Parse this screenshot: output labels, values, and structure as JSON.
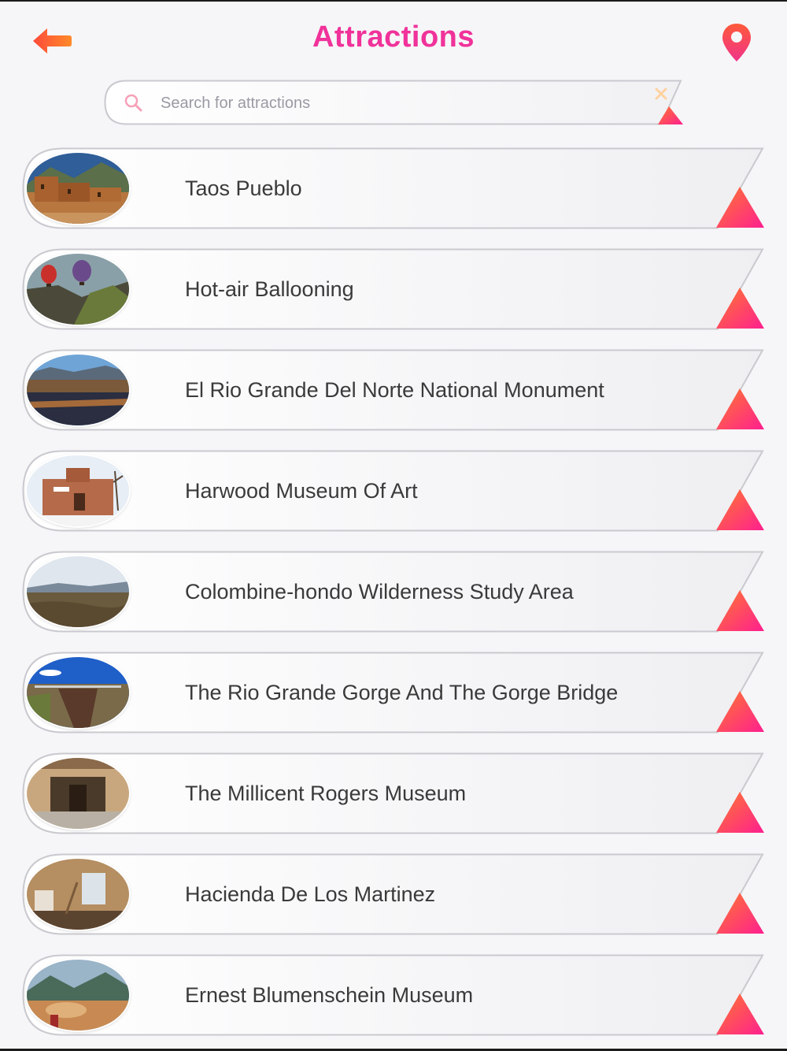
{
  "header": {
    "title": "Attractions",
    "back_icon": "back-arrow-icon",
    "map_icon": "map-pin-icon"
  },
  "search": {
    "placeholder": "Search for attractions",
    "value": "",
    "icon": "search-icon",
    "clear_icon": "close-icon"
  },
  "colors": {
    "accent": "#f0329a",
    "gradient_start": "#ff2d8c",
    "gradient_end": "#ff7a2e",
    "text": "#3a3a3a"
  },
  "attractions": [
    {
      "label": "Taos Pueblo"
    },
    {
      "label": "Hot-air Ballooning"
    },
    {
      "label": "El Rio Grande Del Norte National Monument"
    },
    {
      "label": "Harwood Museum Of Art"
    },
    {
      "label": "Colombine-hondo Wilderness Study Area"
    },
    {
      "label": "The Rio Grande Gorge And The Gorge Bridge"
    },
    {
      "label": "The Millicent Rogers Museum"
    },
    {
      "label": "Hacienda De Los Martinez"
    },
    {
      "label": "Ernest Blumenschein Museum"
    }
  ]
}
